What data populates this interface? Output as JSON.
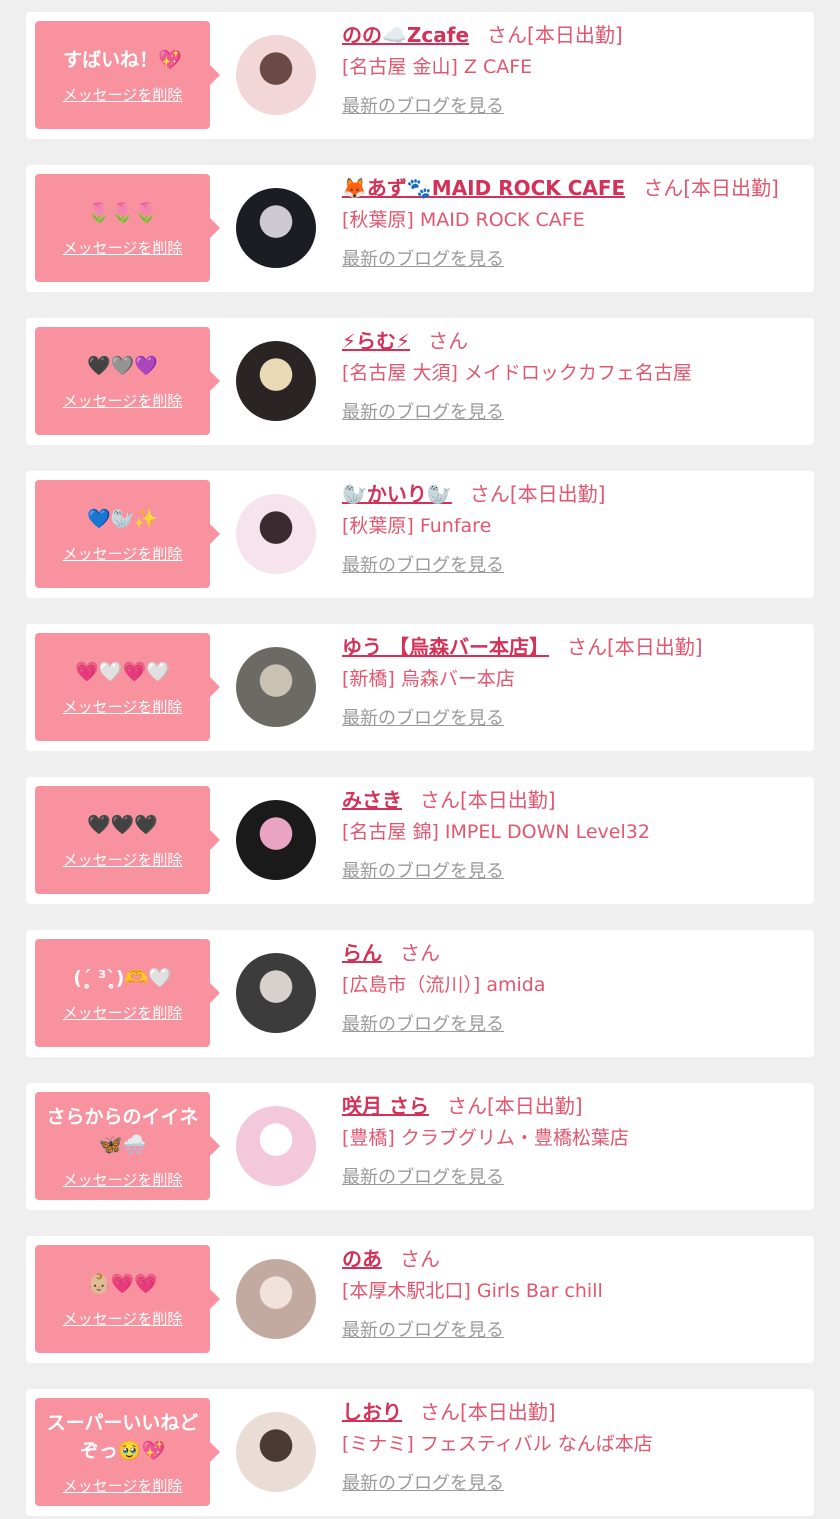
{
  "items": [
    {
      "message": "すばいね！💖",
      "delete_label": "メッセージを削除",
      "name": "のの☁️Zcafe",
      "san": "さん",
      "status": "[本日出勤]",
      "shop": "[名古屋 金山] Z CAFE",
      "blog_label": "最新のブログを見る"
    },
    {
      "message": "🌷🌷🌷",
      "delete_label": "メッセージを削除",
      "name": "🦊あず🐾MAID ROCK CAFE",
      "san": "さん",
      "status": "[本日出勤]",
      "shop": "[秋葉原] MAID ROCK CAFE",
      "blog_label": "最新のブログを見る"
    },
    {
      "message": "🖤🩶💜",
      "delete_label": "メッセージを削除",
      "name": "⚡らむ⚡",
      "san": "さん",
      "status": "",
      "shop": "[名古屋 大須] メイドロックカフェ名古屋",
      "blog_label": "最新のブログを見る"
    },
    {
      "message": "💙🦭✨",
      "delete_label": "メッセージを削除",
      "name": "🦭かいり🦭",
      "san": "さん",
      "status": "[本日出勤]",
      "shop": "[秋葉原] Funfare",
      "blog_label": "最新のブログを見る"
    },
    {
      "message": "💗🤍💗🤍",
      "delete_label": "メッセージを削除",
      "name": "ゆう 【烏森バー本店】",
      "san": "さん",
      "status": "[本日出勤]",
      "shop": "[新橋] 烏森バー本店",
      "blog_label": "最新のブログを見る"
    },
    {
      "message": "🖤🖤🖤",
      "delete_label": "メッセージを削除",
      "name": "みさき",
      "san": "さん",
      "status": "[本日出勤]",
      "shop": "[名古屋 錦] IMPEL DOWN Level32",
      "blog_label": "最新のブログを見る"
    },
    {
      "message": "(ˊ̥̥̥̥̥ ³ˋ̥̥̥̥̥)🫶🤍",
      "delete_label": "メッセージを削除",
      "name": "らん",
      "san": "さん",
      "status": "",
      "shop": "[広島市（流川）] amida",
      "blog_label": "最新のブログを見る"
    },
    {
      "message": "さらからのイイネ🦋🌨️",
      "delete_label": "メッセージを削除",
      "name": "咲月 さら",
      "san": "さん",
      "status": "[本日出勤]",
      "shop": "[豊橋] クラブグリム・豊橋松葉店",
      "blog_label": "最新のブログを見る"
    },
    {
      "message": "👶🏼💗💗",
      "delete_label": "メッセージを削除",
      "name": "のあ",
      "san": "さん",
      "status": "",
      "shop": "[本厚木駅北口] Girls Bar chill",
      "blog_label": "最新のブログを見る"
    },
    {
      "message": "スーパーいいねどぞっ🥹💖",
      "delete_label": "メッセージを削除",
      "name": "しおり",
      "san": "さん",
      "status": "[本日出勤]",
      "shop": "[ミナミ] フェスティバル なんば本店",
      "blog_label": "最新のブログを見る"
    }
  ],
  "avatar_colors": [
    [
      "#f3d6d8",
      "#6b4a46"
    ],
    [
      "#1c1c24",
      "#cfc9d4"
    ],
    [
      "#2a2424",
      "#e9d9b6"
    ],
    [
      "#f6e3ee",
      "#3b2b30"
    ],
    [
      "#6b6a64",
      "#c9c2b2"
    ],
    [
      "#1a1a1a",
      "#e9a3c3"
    ],
    [
      "#3c3c3c",
      "#d8d0cc"
    ],
    [
      "#f3c8da",
      "#ffffff"
    ],
    [
      "#c2aaa0",
      "#f0e1da"
    ],
    [
      "#e9ddd6",
      "#4a3a33"
    ]
  ]
}
